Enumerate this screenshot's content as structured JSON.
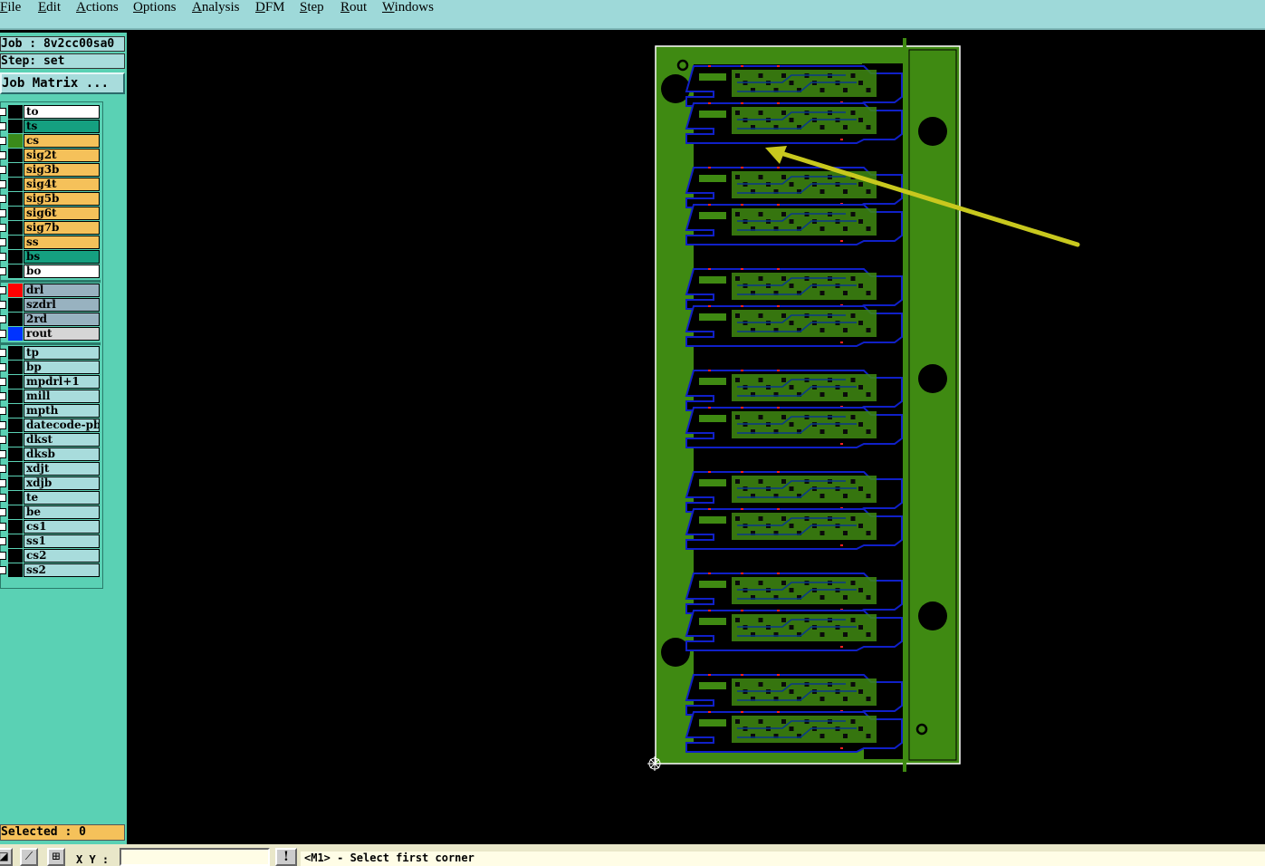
{
  "menu": [
    "File",
    "Edit",
    "Actions",
    "Options",
    "Analysis",
    "DFM",
    "Step",
    "Rout",
    "Windows"
  ],
  "job_label": "Job : 8v2cc00sa0",
  "step_label": "Step: set",
  "job_matrix_button": "Job Matrix ...",
  "layer_groups": [
    [
      {
        "name": "to",
        "bg": "#ffffff",
        "swatch": "#000000"
      },
      {
        "name": "ts",
        "bg": "#15a080",
        "swatch": "#000000"
      },
      {
        "name": "cs",
        "bg": "#f5c15a",
        "swatch": "#3a8a1a"
      },
      {
        "name": "sig2t",
        "bg": "#f5c15a",
        "swatch": "#000000"
      },
      {
        "name": "sig3b",
        "bg": "#f5c15a",
        "swatch": "#000000"
      },
      {
        "name": "sig4t",
        "bg": "#f5c15a",
        "swatch": "#000000"
      },
      {
        "name": "sig5b",
        "bg": "#f5c15a",
        "swatch": "#000000"
      },
      {
        "name": "sig6t",
        "bg": "#f5c15a",
        "swatch": "#000000"
      },
      {
        "name": "sig7b",
        "bg": "#f5c15a",
        "swatch": "#000000"
      },
      {
        "name": "ss",
        "bg": "#f5c15a",
        "swatch": "#000000"
      },
      {
        "name": "bs",
        "bg": "#15a080",
        "swatch": "#000000"
      },
      {
        "name": "bo",
        "bg": "#ffffff",
        "swatch": "#000000"
      }
    ],
    [
      {
        "name": "drl",
        "bg": "#98b2c0",
        "swatch": "#ff0000"
      },
      {
        "name": "szdrl",
        "bg": "#98b2c0",
        "swatch": "#000000"
      },
      {
        "name": "2rd",
        "bg": "#98b2c0",
        "swatch": "#000000"
      },
      {
        "name": "rout",
        "bg": "#d6d6d6",
        "swatch": "#0033ff"
      }
    ],
    [
      {
        "name": "tp",
        "bg": "#a8dcdc",
        "swatch": "#000000"
      },
      {
        "name": "bp",
        "bg": "#a8dcdc",
        "swatch": "#000000"
      },
      {
        "name": "mpdrl+1",
        "bg": "#a8dcdc",
        "swatch": "#000000"
      },
      {
        "name": "mill",
        "bg": "#a8dcdc",
        "swatch": "#000000"
      },
      {
        "name": "mpth",
        "bg": "#a8dcdc",
        "swatch": "#000000"
      },
      {
        "name": "datecode-pbe",
        "bg": "#a8dcdc",
        "swatch": "#000000"
      },
      {
        "name": "dkst",
        "bg": "#a8dcdc",
        "swatch": "#000000"
      },
      {
        "name": "dksb",
        "bg": "#a8dcdc",
        "swatch": "#000000"
      },
      {
        "name": "xdjt",
        "bg": "#a8dcdc",
        "swatch": "#000000"
      },
      {
        "name": "xdjb",
        "bg": "#a8dcdc",
        "swatch": "#000000"
      },
      {
        "name": "te",
        "bg": "#a8dcdc",
        "swatch": "#000000"
      },
      {
        "name": "be",
        "bg": "#a8dcdc",
        "swatch": "#000000"
      },
      {
        "name": "cs1",
        "bg": "#a8dcdc",
        "swatch": "#000000"
      },
      {
        "name": "ss1",
        "bg": "#a8dcdc",
        "swatch": "#000000"
      },
      {
        "name": "cs2",
        "bg": "#a8dcdc",
        "swatch": "#000000"
      },
      {
        "name": "ss2",
        "bg": "#a8dcdc",
        "swatch": "#000000"
      }
    ]
  ],
  "selected_label": "Selected : 0",
  "xy_label": "X Y :",
  "xy_value": "",
  "status_message": "<M1> - Select first corner",
  "board": {
    "panel_count": 7,
    "colors": {
      "copper": "#3f8a12",
      "outline": "#ffffff",
      "rout": "#1020c8",
      "arrow": "#c8c81e",
      "drill": "#ff2020",
      "trace": "#0a3a8a"
    }
  }
}
